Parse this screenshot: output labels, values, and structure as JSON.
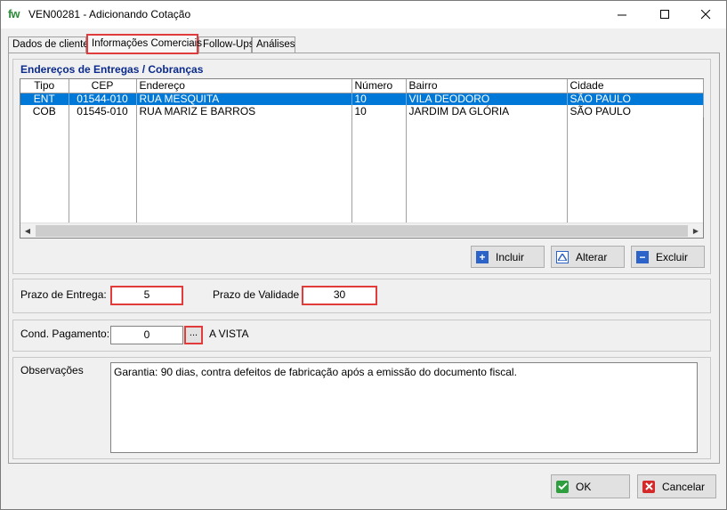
{
  "window": {
    "app_icon": "fw",
    "title": "VEN00281 -  Adicionando Cotação",
    "minimize_icon": "minimize-icon",
    "maximize_icon": "maximize-icon",
    "close_icon": "close-icon"
  },
  "tabs": [
    {
      "label": "Dados de cliente",
      "active": false
    },
    {
      "label": "Informações Comerciais",
      "active": true
    },
    {
      "label": "Follow-Ups",
      "active": false
    },
    {
      "label": "Análises",
      "active": false
    }
  ],
  "addresses": {
    "title": "Endereços de Entregas / Cobranças",
    "columns": [
      "Tipo",
      "CEP",
      "Endereço",
      "Número",
      "Bairro",
      "Cidade"
    ],
    "rows": [
      {
        "tipo": "ENT",
        "cep": "01544-010",
        "endereco": "RUA MESQUITA",
        "numero": "10",
        "bairro": "VILA DEODORO",
        "cidade": "SÃO PAULO",
        "selected": true
      },
      {
        "tipo": "COB",
        "cep": "01545-010",
        "endereco": "RUA MARIZ E BARROS",
        "numero": "10",
        "bairro": "JARDIM DA GLÓRIA",
        "cidade": "SÃO PAULO",
        "selected": false
      }
    ],
    "buttons": {
      "incluir": "Incluir",
      "alterar": "Alterar",
      "excluir": "Excluir"
    }
  },
  "prazos": {
    "entrega_label": "Prazo de Entrega:",
    "entrega_value": "5",
    "validade_label": "Prazo de Validade",
    "validade_value": "30"
  },
  "pagamento": {
    "label": "Cond. Pagamento:",
    "value": "0",
    "lookup_label": "...",
    "description": "A VISTA"
  },
  "observacoes": {
    "label": "Observações",
    "text": "Garantia: 90 dias, contra defeitos de fabricação após a emissão do documento fiscal."
  },
  "footer": {
    "ok_label": "OK",
    "cancel_label": "Cancelar"
  },
  "colors": {
    "highlight": "#e23b3b",
    "selection": "#0078d7",
    "group_title": "#0a2a8c"
  }
}
